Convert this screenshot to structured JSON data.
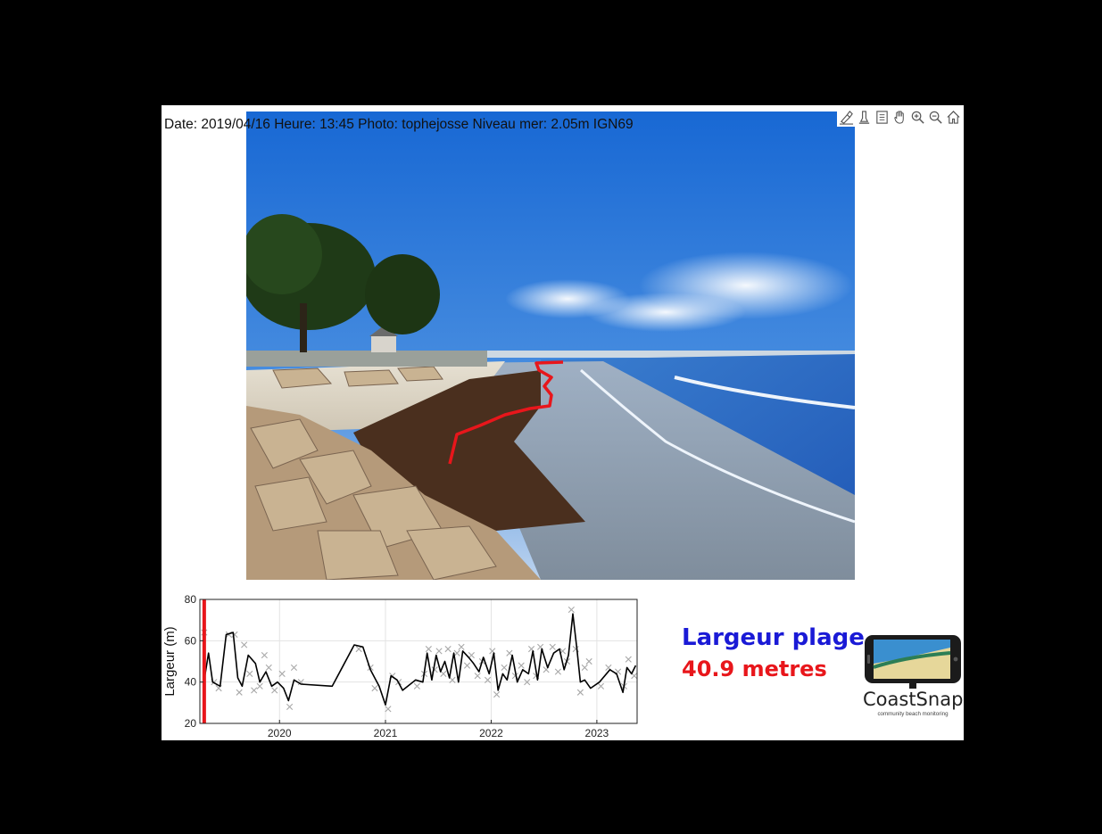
{
  "header": {
    "text": "Date: 2019/04/16 Heure: 13:45 Photo: tophejosse Niveau mer: 2.05m IGN69"
  },
  "toolbar": {
    "icons": [
      "brush-icon",
      "data-cursor-icon",
      "legend-icon",
      "pan-hand-icon",
      "zoom-in-icon",
      "zoom-out-icon",
      "home-icon"
    ]
  },
  "panel": {
    "title": "Largeur plage",
    "value": "40.9 metres",
    "title_color": "#1a1ad6",
    "value_color": "#e8161b"
  },
  "logo": {
    "name": "CoastSnap",
    "tagline": "community beach monitoring"
  },
  "colors": {
    "shoreline": "#e8161b",
    "series_line": "#000000",
    "series_markers": "#a8a8a8"
  },
  "chart_data": {
    "type": "line",
    "title": "",
    "xlabel": "",
    "ylabel": "Largeur (m)",
    "ylim": [
      20,
      80
    ],
    "yticks": [
      20,
      40,
      60,
      80
    ],
    "xlim": [
      "2019-04-01",
      "2023-05-20"
    ],
    "xticks": [
      {
        "x": "2020-01-01",
        "label": "2020"
      },
      {
        "x": "2021-01-01",
        "label": "2021"
      },
      {
        "x": "2022-01-01",
        "label": "2022"
      },
      {
        "x": "2023-01-01",
        "label": "2023"
      }
    ],
    "grid": true,
    "marker_current": {
      "x": "2019-04-16",
      "color": "#e8161b"
    },
    "series": [
      {
        "line": [
          [
            "2019-04-16",
            41
          ],
          [
            "2019-05-01",
            54
          ],
          [
            "2019-05-15",
            40
          ],
          [
            "2019-06-10",
            38
          ],
          [
            "2019-07-01",
            63
          ],
          [
            "2019-07-25",
            64
          ],
          [
            "2019-08-10",
            42
          ],
          [
            "2019-08-25",
            38
          ],
          [
            "2019-09-15",
            53
          ],
          [
            "2019-10-10",
            49
          ],
          [
            "2019-10-25",
            40
          ],
          [
            "2019-11-15",
            45
          ],
          [
            "2019-12-05",
            38
          ],
          [
            "2019-12-25",
            40
          ],
          [
            "2020-01-15",
            37
          ],
          [
            "2020-02-01",
            31
          ],
          [
            "2020-02-20",
            41
          ],
          [
            "2020-03-15",
            39
          ],
          [
            "2020-07-01",
            38
          ],
          [
            "2020-09-15",
            58
          ],
          [
            "2020-10-15",
            57
          ],
          [
            "2020-11-10",
            46
          ],
          [
            "2020-12-10",
            38
          ],
          [
            "2021-01-01",
            29
          ],
          [
            "2021-01-20",
            43
          ],
          [
            "2021-02-10",
            41
          ],
          [
            "2021-03-01",
            36
          ],
          [
            "2021-04-15",
            41
          ],
          [
            "2021-05-10",
            40
          ],
          [
            "2021-05-25",
            54
          ],
          [
            "2021-06-10",
            41
          ],
          [
            "2021-06-25",
            53
          ],
          [
            "2021-07-10",
            45
          ],
          [
            "2021-07-25",
            50
          ],
          [
            "2021-08-10",
            42
          ],
          [
            "2021-08-25",
            54
          ],
          [
            "2021-09-10",
            40
          ],
          [
            "2021-09-25",
            55
          ],
          [
            "2021-10-15",
            52
          ],
          [
            "2021-11-01",
            49
          ],
          [
            "2021-11-20",
            45
          ],
          [
            "2021-12-05",
            52
          ],
          [
            "2021-12-25",
            44
          ],
          [
            "2022-01-10",
            54
          ],
          [
            "2022-01-25",
            36
          ],
          [
            "2022-02-10",
            44
          ],
          [
            "2022-02-25",
            41
          ],
          [
            "2022-03-15",
            53
          ],
          [
            "2022-04-01",
            40
          ],
          [
            "2022-04-20",
            46
          ],
          [
            "2022-05-10",
            44
          ],
          [
            "2022-05-25",
            55
          ],
          [
            "2022-06-10",
            41
          ],
          [
            "2022-06-25",
            56
          ],
          [
            "2022-07-15",
            47
          ],
          [
            "2022-08-05",
            54
          ],
          [
            "2022-08-25",
            56
          ],
          [
            "2022-09-10",
            46
          ],
          [
            "2022-09-25",
            53
          ],
          [
            "2022-10-10",
            73
          ],
          [
            "2022-10-25",
            55
          ],
          [
            "2022-11-05",
            40
          ],
          [
            "2022-11-20",
            41
          ],
          [
            "2022-12-10",
            37
          ],
          [
            "2023-01-10",
            40
          ],
          [
            "2023-02-15",
            46
          ],
          [
            "2023-03-10",
            44
          ],
          [
            "2023-04-01",
            35
          ],
          [
            "2023-04-15",
            47
          ],
          [
            "2023-05-01",
            44
          ],
          [
            "2023-05-15",
            48
          ]
        ],
        "markers": [
          [
            "2019-04-16",
            64
          ],
          [
            "2019-05-20",
            40
          ],
          [
            "2019-06-05",
            37
          ],
          [
            "2019-07-10",
            63
          ],
          [
            "2019-07-30",
            63
          ],
          [
            "2019-08-15",
            35
          ],
          [
            "2019-09-01",
            58
          ],
          [
            "2019-09-20",
            44
          ],
          [
            "2019-10-05",
            36
          ],
          [
            "2019-10-25",
            38
          ],
          [
            "2019-11-10",
            53
          ],
          [
            "2019-11-25",
            47
          ],
          [
            "2019-12-15",
            36
          ],
          [
            "2020-01-10",
            44
          ],
          [
            "2020-02-05",
            28
          ],
          [
            "2020-02-20",
            47
          ],
          [
            "2020-03-15",
            40
          ],
          [
            "2020-10-01",
            56
          ],
          [
            "2020-11-10",
            47
          ],
          [
            "2020-11-25",
            37
          ],
          [
            "2021-01-10",
            27
          ],
          [
            "2021-01-25",
            43
          ],
          [
            "2021-02-15",
            40
          ],
          [
            "2021-04-20",
            38
          ],
          [
            "2021-05-15",
            44
          ],
          [
            "2021-05-30",
            56
          ],
          [
            "2021-06-20",
            46
          ],
          [
            "2021-07-05",
            55
          ],
          [
            "2021-07-20",
            44
          ],
          [
            "2021-08-05",
            56
          ],
          [
            "2021-08-20",
            41
          ],
          [
            "2021-09-05",
            54
          ],
          [
            "2021-09-20",
            57
          ],
          [
            "2021-10-10",
            48
          ],
          [
            "2021-10-25",
            53
          ],
          [
            "2021-11-15",
            43
          ],
          [
            "2021-12-01",
            50
          ],
          [
            "2021-12-20",
            41
          ],
          [
            "2022-01-05",
            55
          ],
          [
            "2022-01-20",
            34
          ],
          [
            "2022-02-15",
            47
          ],
          [
            "2022-03-05",
            54
          ],
          [
            "2022-03-25",
            43
          ],
          [
            "2022-04-15",
            48
          ],
          [
            "2022-05-05",
            40
          ],
          [
            "2022-05-20",
            56
          ],
          [
            "2022-06-05",
            43
          ],
          [
            "2022-06-20",
            57
          ],
          [
            "2022-07-10",
            46
          ],
          [
            "2022-08-01",
            57
          ],
          [
            "2022-08-20",
            45
          ],
          [
            "2022-09-05",
            55
          ],
          [
            "2022-09-20",
            50
          ],
          [
            "2022-10-05",
            75
          ],
          [
            "2022-10-20",
            56
          ],
          [
            "2022-11-05",
            35
          ],
          [
            "2022-11-20",
            47
          ],
          [
            "2022-12-05",
            50
          ],
          [
            "2023-01-15",
            38
          ],
          [
            "2023-02-10",
            47
          ],
          [
            "2023-03-15",
            45
          ],
          [
            "2023-04-05",
            38
          ],
          [
            "2023-04-20",
            51
          ],
          [
            "2023-05-10",
            43
          ]
        ]
      }
    ]
  }
}
